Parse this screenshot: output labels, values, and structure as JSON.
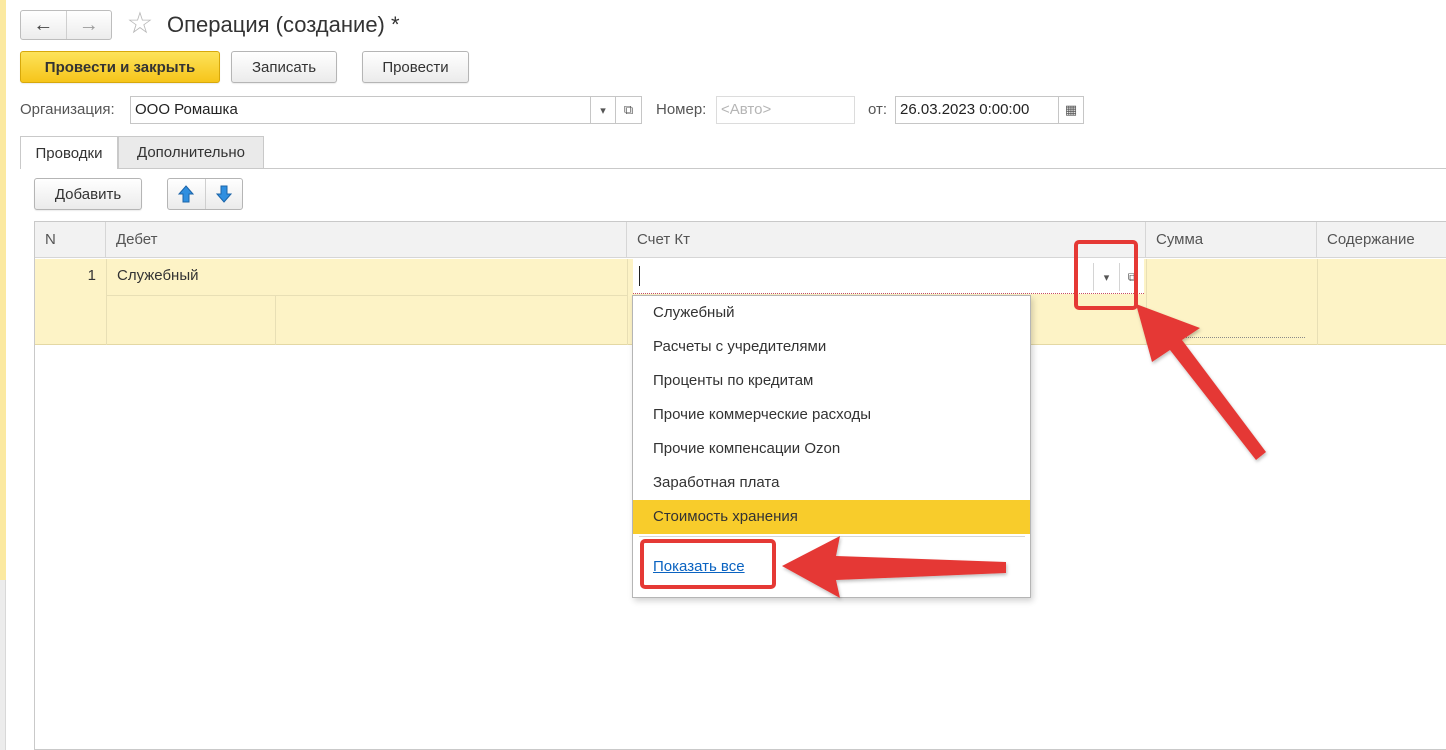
{
  "window": {
    "title": "Операция (создание) *"
  },
  "toolbar": {
    "post_close_label": "Провести и закрыть",
    "save_label": "Записать",
    "post_label": "Провести"
  },
  "form": {
    "organization_label": "Организация:",
    "organization_value": "ООО Ромашка",
    "number_label": "Номер:",
    "number_placeholder": "<Авто>",
    "date_label": "от:",
    "date_value": "26.03.2023  0:00:00"
  },
  "tabs": [
    {
      "label": "Проводки",
      "active": true
    },
    {
      "label": "Дополнительно",
      "active": false
    }
  ],
  "table_toolbar": {
    "add_label": "Добавить"
  },
  "table": {
    "columns": [
      "N",
      "Дебет",
      "Счет Кт",
      "Сумма",
      "Содержание"
    ],
    "rows": [
      {
        "n": "1",
        "debit": "Служебный",
        "credit": ""
      }
    ]
  },
  "dropdown": {
    "items": [
      "Служебный",
      "Расчеты с учредителями",
      "Проценты по кредитам",
      "Прочие коммерческие расходы",
      "Прочие компенсации Ozon",
      "Заработная плата",
      "Стоимость хранения"
    ],
    "selected_index": 6,
    "show_all_label": "Показать все"
  },
  "colors": {
    "accent_yellow": "#f8cc2b",
    "row_highlight": "#fdf3c6",
    "annotation_red": "#e53935",
    "link_blue": "#0a63c1"
  }
}
